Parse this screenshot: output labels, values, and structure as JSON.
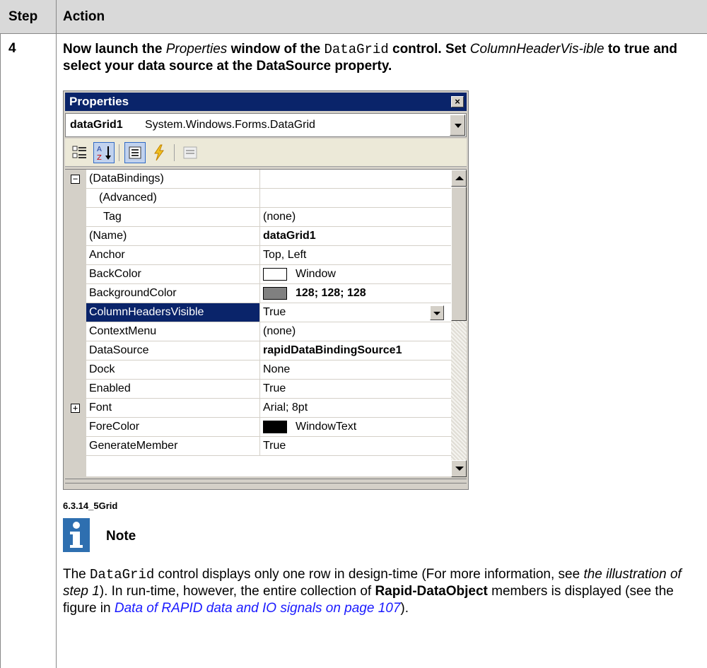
{
  "table": {
    "header_step": "Step",
    "header_action": "Action",
    "step_number": "4"
  },
  "instruction": {
    "t1": "Now launch the ",
    "t2": "Properties",
    "t3": " window of the ",
    "t4": "DataGrid",
    "t5": " control. Set ",
    "t6": "ColumnHeaderVis-ible",
    "t7": " to true and select your data source at the ",
    "t8": "DataSource",
    "t9": " property."
  },
  "properties_window": {
    "title": "Properties",
    "close_label": "×",
    "object_name": "dataGrid1",
    "object_type": "System.Windows.Forms.DataGrid",
    "rows": [
      {
        "name": "(DataBindings)",
        "value": "",
        "expander": "−"
      },
      {
        "name": "(Advanced)",
        "value": ""
      },
      {
        "name": "Tag",
        "value": "(none)"
      },
      {
        "name": "(Name)",
        "value": "dataGrid1"
      },
      {
        "name": "Anchor",
        "value": "Top, Left"
      },
      {
        "name": "BackColor",
        "value": "Window",
        "swatch": "#ffffff"
      },
      {
        "name": "BackgroundColor",
        "value": "128; 128; 128",
        "swatch": "#808080"
      },
      {
        "name": "ColumnHeadersVisible",
        "value": "True"
      },
      {
        "name": "ContextMenu",
        "value": "(none)"
      },
      {
        "name": "DataSource",
        "value": "rapidDataBindingSource1"
      },
      {
        "name": "Dock",
        "value": "None"
      },
      {
        "name": "Enabled",
        "value": "True"
      },
      {
        "name": "Font",
        "value": "Arial; 8pt",
        "expander": "+"
      },
      {
        "name": "ForeColor",
        "value": "WindowText",
        "swatch": "#000000"
      },
      {
        "name": "GenerateMember",
        "value": "True"
      }
    ]
  },
  "caption": "6.3.14_5Grid",
  "note": {
    "title": "Note",
    "b1": "The ",
    "b2": "DataGrid",
    "b3": " control displays only one row in design-time (For more information, see ",
    "b4": "the illustration of step 1",
    "b5": "). In run-time, however, the entire collection of ",
    "b6": "Rapid-DataObject",
    "b7": " members is displayed (see the figure in ",
    "b8": "Data of RAPID data and IO signals on page 107",
    "b9": ")."
  },
  "colors": {
    "header_bg": "#d9d9d9",
    "titlebar": "#0a246a",
    "note_icon": "#2e6fb0",
    "link": "#1a1aff"
  }
}
